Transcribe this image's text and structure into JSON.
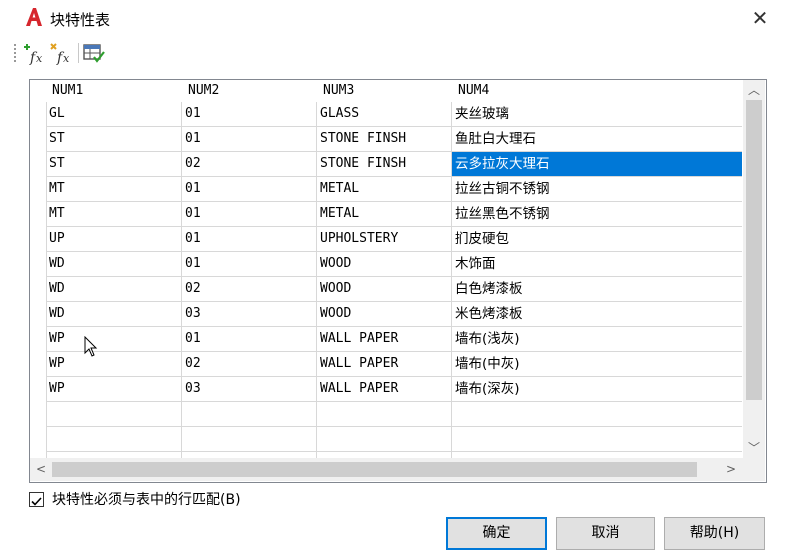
{
  "window": {
    "title": "块特性表",
    "close_glyph": "✕",
    "app_icon": "autocad-a-icon"
  },
  "toolbar": {
    "buttons": [
      "add-function-icon",
      "edit-function-icon",
      "table-check-icon"
    ]
  },
  "table": {
    "columns": [
      "NUM1",
      "NUM2",
      "NUM3",
      "NUM4"
    ],
    "rows": [
      [
        "GL",
        "01",
        "GLASS",
        "夹丝玻璃"
      ],
      [
        "ST",
        "01",
        "STONE FINSH",
        "鱼肚白大理石"
      ],
      [
        "ST",
        "02",
        "STONE FINSH",
        "云多拉灰大理石"
      ],
      [
        "MT",
        "01",
        "METAL",
        "拉丝古铜不锈钢"
      ],
      [
        "MT",
        "01",
        "METAL",
        "拉丝黑色不锈钢"
      ],
      [
        "UP",
        "01",
        "UPHOLSTERY",
        "扪皮硬包"
      ],
      [
        "WD",
        "01",
        "WOOD",
        "木饰面"
      ],
      [
        "WD",
        "02",
        "WOOD",
        "白色烤漆板"
      ],
      [
        "WD",
        "03",
        "WOOD",
        "米色烤漆板"
      ],
      [
        "WP",
        "01",
        "WALL PAPER",
        "墙布(浅灰)"
      ],
      [
        "WP",
        "02",
        "WALL PAPER",
        "墙布(中灰)"
      ],
      [
        "WP",
        "03",
        "WALL PAPER",
        "墙布(深灰)"
      ]
    ],
    "empty_rows": 2,
    "selected": {
      "row": 2,
      "col": 3
    },
    "selection_color": "#0078d7"
  },
  "scrollbar": {
    "up": "︿",
    "down": "﹀",
    "left": "<",
    "right": ">"
  },
  "checkbox": {
    "label": "块特性必须与表中的行匹配(B)",
    "checked": true
  },
  "buttons": {
    "ok": "确定",
    "cancel": "取消",
    "help": "帮助(H)"
  }
}
